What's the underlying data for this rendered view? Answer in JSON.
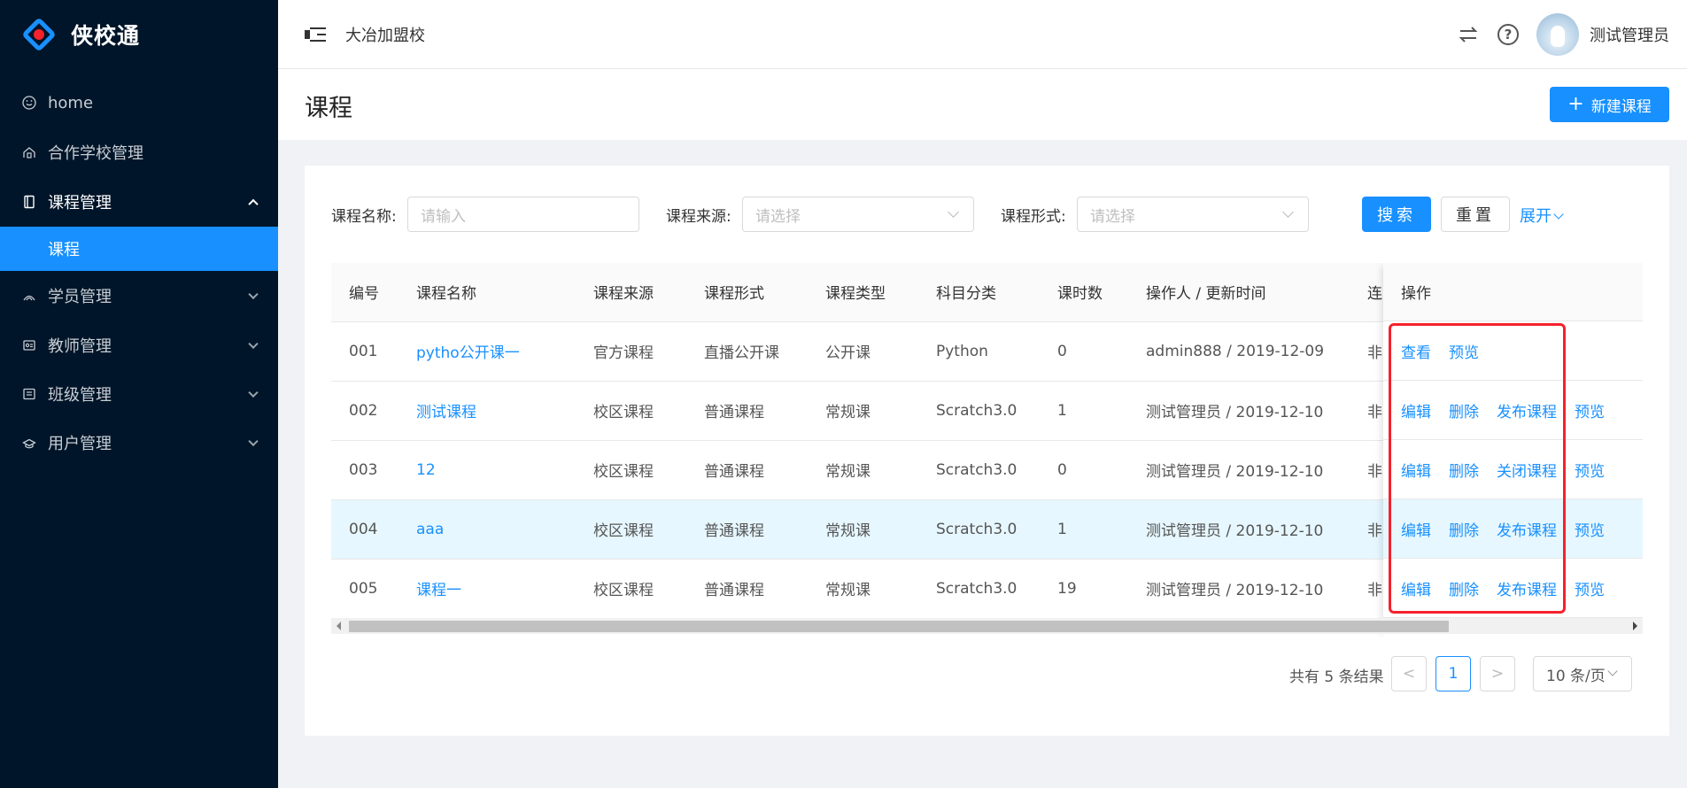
{
  "app": {
    "name": "侠校通"
  },
  "sidebar": {
    "items": [
      {
        "label": "home",
        "icon": "smile-icon"
      },
      {
        "label": "合作学校管理",
        "icon": "school-icon"
      },
      {
        "label": "课程管理",
        "icon": "book-icon",
        "open": true,
        "children": [
          {
            "label": "课程",
            "active": true
          }
        ]
      },
      {
        "label": "学员管理",
        "icon": "student-icon"
      },
      {
        "label": "教师管理",
        "icon": "teacher-icon"
      },
      {
        "label": "班级管理",
        "icon": "class-icon"
      },
      {
        "label": "用户管理",
        "icon": "users-icon"
      }
    ]
  },
  "header": {
    "school": "大冶加盟校",
    "user_name": "测试管理员"
  },
  "page": {
    "title": "课程",
    "new_button": "新建课程"
  },
  "filters": {
    "name_label": "课程名称:",
    "name_placeholder": "请输入",
    "source_label": "课程来源:",
    "source_placeholder": "请选择",
    "form_label": "课程形式:",
    "form_placeholder": "请选择",
    "search_label": "搜索",
    "reset_label": "重置",
    "expand_label": "展开"
  },
  "table": {
    "columns": [
      "编号",
      "课程名称",
      "课程来源",
      "课程形式",
      "课程类型",
      "科目分类",
      "课时数",
      "操作人 / 更新时间",
      "连"
    ],
    "ops_header": "操作",
    "rows": [
      {
        "id": "001",
        "name": "pytho公开课一",
        "source": "官方课程",
        "form": "直播公开课",
        "type": "公开课",
        "subject": "Python",
        "hours": "0",
        "operator": "admin888 / 2019-12-09",
        "extra": "非",
        "ops": [
          "查看",
          "预览"
        ]
      },
      {
        "id": "002",
        "name": "测试课程",
        "source": "校区课程",
        "form": "普通课程",
        "type": "常规课",
        "subject": "Scratch3.0",
        "hours": "1",
        "operator": "测试管理员 / 2019-12-10",
        "extra": "非",
        "ops": [
          "编辑",
          "删除",
          "发布课程",
          "预览"
        ]
      },
      {
        "id": "003",
        "name": "12",
        "source": "校区课程",
        "form": "普通课程",
        "type": "常规课",
        "subject": "Scratch3.0",
        "hours": "0",
        "operator": "测试管理员 / 2019-12-10",
        "extra": "非",
        "ops": [
          "编辑",
          "删除",
          "关闭课程",
          "预览"
        ]
      },
      {
        "id": "004",
        "name": "aaa",
        "source": "校区课程",
        "form": "普通课程",
        "type": "常规课",
        "subject": "Scratch3.0",
        "hours": "1",
        "operator": "测试管理员 / 2019-12-10",
        "extra": "非",
        "ops": [
          "编辑",
          "删除",
          "发布课程",
          "预览"
        ],
        "highlighted": true
      },
      {
        "id": "005",
        "name": "课程一",
        "source": "校区课程",
        "form": "普通课程",
        "type": "常规课",
        "subject": "Scratch3.0",
        "hours": "19",
        "operator": "测试管理员 / 2019-12-10",
        "extra": "非",
        "ops": [
          "编辑",
          "删除",
          "发布课程",
          "预览"
        ]
      }
    ]
  },
  "pagination": {
    "total_text": "共有 5 条结果",
    "prev": "<",
    "current": "1",
    "next": ">",
    "page_size": "10 条/页"
  },
  "colors": {
    "primary": "#1890ff",
    "sidebar_bg": "#001529",
    "highlight_box": "#f5222d",
    "row_highlight": "#e6f7ff"
  }
}
